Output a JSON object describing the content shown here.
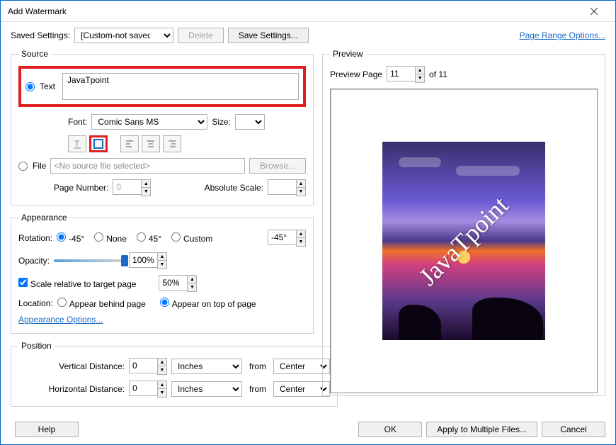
{
  "titlebar": {
    "title": "Add Watermark"
  },
  "toprow": {
    "saved_settings_label": "Saved Settings:",
    "saved_settings_value": "[Custom-not saved]",
    "delete_label": "Delete",
    "save_settings_label": "Save Settings...",
    "page_range_link": "Page Range Options..."
  },
  "source": {
    "legend": "Source",
    "text_radio": "Text",
    "text_value": "JavaTpoint",
    "font_label": "Font:",
    "font_value": "Comic Sans MS",
    "size_label": "Size:",
    "size_value": "",
    "file_radio": "File",
    "file_value": "<No source file selected>",
    "browse_label": "Browse...",
    "page_number_label": "Page Number:",
    "page_number_value": "0",
    "absolute_scale_label": "Absolute Scale:",
    "absolute_scale_value": ""
  },
  "appearance": {
    "legend": "Appearance",
    "rotation_label": "Rotation:",
    "rot_m45": "-45°",
    "rot_none": "None",
    "rot_45": "45°",
    "rot_custom": "Custom",
    "rot_value": "-45°",
    "opacity_label": "Opacity:",
    "opacity_value": "100%",
    "scale_check_label": "Scale relative to target page",
    "scale_value": "50%",
    "location_label": "Location:",
    "loc_behind": "Appear behind page",
    "loc_top": "Appear on top of page",
    "appearance_options": "Appearance Options..."
  },
  "position": {
    "legend": "Position",
    "vdist_label": "Vertical Distance:",
    "vdist_value": "0",
    "vdist_unit": "Inches",
    "from": "from",
    "vdist_from": "Center",
    "hdist_label": "Horizontal Distance:",
    "hdist_value": "0",
    "hdist_unit": "Inches",
    "hdist_from": "Center"
  },
  "preview": {
    "legend": "Preview",
    "page_label": "Preview Page",
    "page_value": "11",
    "of_text": "of 11",
    "watermark_text": "JavaTpoint"
  },
  "footer": {
    "help": "Help",
    "ok": "OK",
    "apply": "Apply to Multiple Files...",
    "cancel": "Cancel"
  }
}
